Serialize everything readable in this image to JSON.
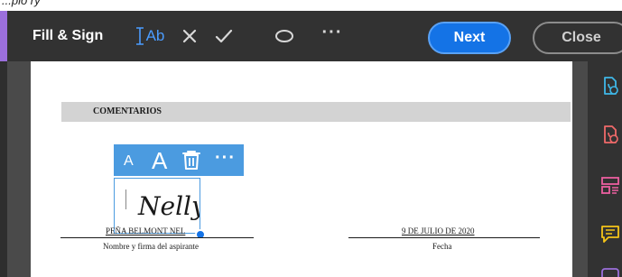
{
  "top_strip": {
    "text": "...plo ry"
  },
  "toolbar": {
    "title": "Fill & Sign",
    "tools": [
      {
        "name": "add-text-tool",
        "icon": "text-cursor-icon",
        "label": "Ab"
      },
      {
        "name": "cross-mark-tool",
        "icon": "x-icon"
      },
      {
        "name": "checkmark-tool",
        "icon": "checkmark-icon"
      },
      {
        "name": "ellipse-tool",
        "icon": "ellipse-icon"
      },
      {
        "name": "more-tools",
        "icon": "more-icon",
        "label": "···"
      }
    ],
    "next_label": "Next",
    "close_label": "Close",
    "accent_color": "#9b6fdc",
    "active_tool_color": "#4b9cff",
    "next_color": "#1473e6"
  },
  "document": {
    "section_header": "COMENTARIOS",
    "signature_tools": {
      "small_text_label": "A",
      "large_text_label": "A",
      "more_label": "···"
    },
    "signature_text": "Nelly",
    "name_value": "PEÑA BELMONT NEL",
    "name_caption": "Nombre y firma del aspirante",
    "date_value": "9 DE JULIO DE 2020",
    "date_caption": "Fecha"
  },
  "right_rail": {
    "icons": [
      "export-pdf-icon",
      "edit-pdf-icon",
      "organize-pages-icon",
      "comment-icon",
      "more-tools-icon"
    ],
    "colors": [
      "#3fb8e8",
      "#f06a6a",
      "#ec5fa0",
      "#f5c518",
      "#9b6fdc"
    ]
  }
}
